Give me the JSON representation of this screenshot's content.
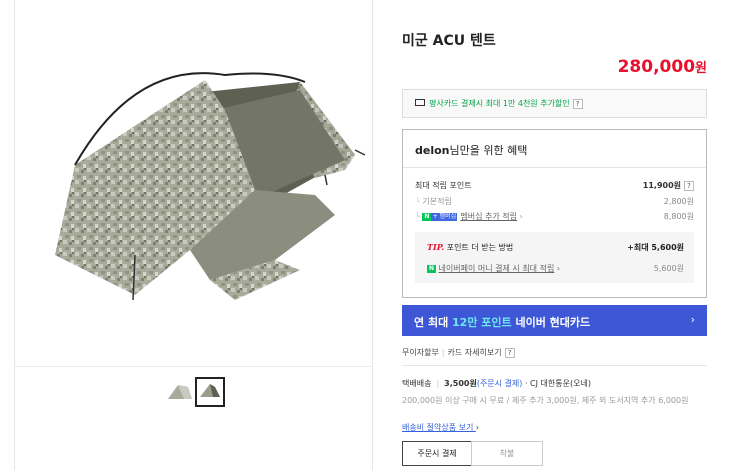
{
  "product": {
    "title": "미군 ACU 텐트",
    "price": "280,000",
    "currency": "원"
  },
  "gallery": {
    "main_image": "tent-photo",
    "thumbnails": [
      "tent-thumb-1",
      "tent-thumb-2"
    ],
    "selected_index": 1
  },
  "promo": {
    "icon": "credit-card-icon",
    "text": "평사카드 결제시 최대 1만 4천원 추가할인",
    "help": "?"
  },
  "benefit": {
    "user": "delon",
    "title_suffix": "님만을 위한 혜택",
    "max_points_label": "최대 적립 포인트",
    "max_points_value": "11,900원",
    "help": "?",
    "basic_label": "기본적립",
    "basic_value": "2,800원",
    "badge_n": "N",
    "badge_plus": "+ 멤버십",
    "membership_label": "멤버십 추가 적립",
    "membership_arrow": "›",
    "membership_value": "8,800원",
    "tip_mark": "TIP.",
    "tip_text": " 포인트 더 받는 방법",
    "tip_value": "+최대 5,600원",
    "pay_label": "네이버페이 머니 결제 시 최대 적립",
    "pay_arrow": "›",
    "pay_value": "5,600원"
  },
  "banner": {
    "pre": "연 최대 ",
    "highlight": "12만 포인트",
    "post": " 네이버 현대카드",
    "arrow": "›"
  },
  "installment": {
    "label1": "무이자할부",
    "sep": "|",
    "label2": "카드 자세히보기",
    "help": "?"
  },
  "shipping": {
    "label": "택배배송",
    "fee": "3,500원",
    "fee_note": "(주문시 결제)",
    "courier": "· CJ 대한통운(오네)",
    "note": "200,000원 이상 구매 시 무료 / 제주 추가 3,000원, 제주 외 도서지역 추가 6,000원",
    "link": "배송비 절약상품 보기",
    "link_arrow": "›"
  },
  "tabs": [
    {
      "label": "주문시 결제",
      "active": true
    },
    {
      "label": "착불",
      "active": false
    }
  ],
  "colors": {
    "price": "#e8112d",
    "promo_text": "#00a44a",
    "banner_bg": "#3d57d6",
    "banner_highlight": "#6ee7f0",
    "link": "#3562d9"
  }
}
